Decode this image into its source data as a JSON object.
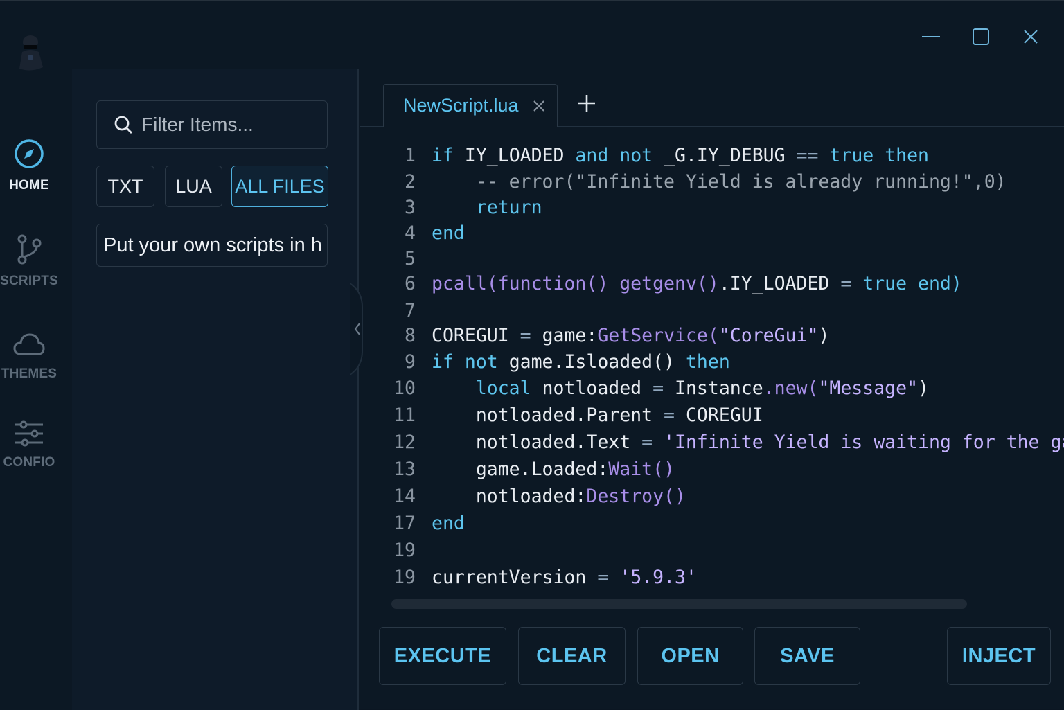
{
  "window_controls": {
    "minimize": "minimize-icon",
    "maximize": "maximize-icon",
    "close": "close-icon"
  },
  "nav": {
    "items": [
      {
        "label": "HOME",
        "icon": "compass-icon",
        "active": true
      },
      {
        "label": "SCRIPTS",
        "icon": "git-branch-icon",
        "active": false
      },
      {
        "label": "THEMES",
        "icon": "cloud-icon",
        "active": false
      },
      {
        "label": "CONFIO",
        "icon": "sliders-icon",
        "active": false
      }
    ]
  },
  "files": {
    "filter_placeholder": "Filter Items...",
    "chips": [
      {
        "label": "TXT"
      },
      {
        "label": "LUA"
      },
      {
        "label": "ALL FILES",
        "active": true
      }
    ],
    "message": "Put your own scripts in h"
  },
  "editor": {
    "tab_name": "NewScript.lua",
    "lines": [
      {
        "n": "1"
      },
      {
        "n": "2"
      },
      {
        "n": "3"
      },
      {
        "n": "4"
      },
      {
        "n": "5"
      },
      {
        "n": "6"
      },
      {
        "n": "7"
      },
      {
        "n": "8"
      },
      {
        "n": "9"
      },
      {
        "n": "10"
      },
      {
        "n": "11"
      },
      {
        "n": "12"
      },
      {
        "n": "13"
      },
      {
        "n": "14"
      },
      {
        "n": "17"
      },
      {
        "n": "19"
      },
      {
        "n": "19"
      }
    ]
  },
  "toolbar": {
    "execute": "EXECUTE",
    "clear": "CLEAR",
    "open": "OPEN",
    "save": "SAVE",
    "inject": "INJECT"
  },
  "colors": {
    "accent": "#5cc4f0",
    "purple": "#a88ee8",
    "bg": "#0c1824",
    "panel": "#0e1b29"
  }
}
